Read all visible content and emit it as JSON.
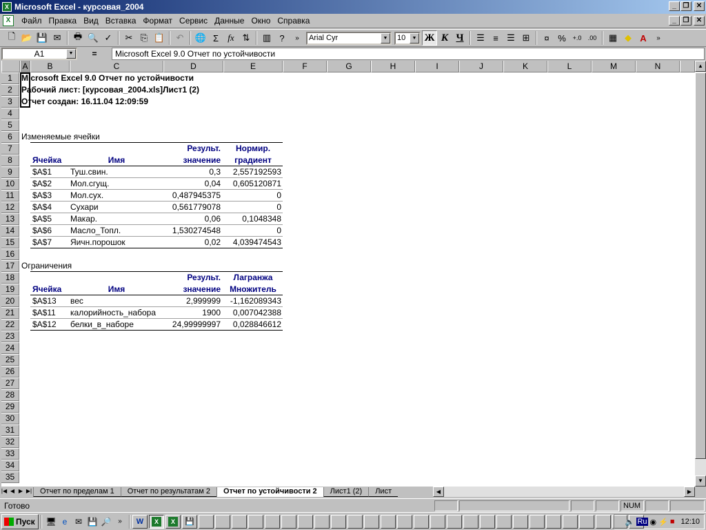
{
  "window": {
    "title": "Microsoft Excel - курсовая_2004"
  },
  "menu": [
    "Файл",
    "Правка",
    "Вид",
    "Вставка",
    "Формат",
    "Сервис",
    "Данные",
    "Окно",
    "Справка"
  ],
  "toolbar": {
    "font_name": "Arial Cyr",
    "font_size": "10",
    "bold": "Ж",
    "italic": "К",
    "underline": "Ч",
    "percent": "%",
    "sigma": "Σ",
    "fx": "fx"
  },
  "formula_bar": {
    "name_box": "A1",
    "equals": "=",
    "content": "Microsoft Excel 9.0 Отчет по устойчивости"
  },
  "columns": [
    "A",
    "B",
    "C",
    "D",
    "E",
    "F",
    "G",
    "H",
    "I",
    "J",
    "K",
    "L",
    "M",
    "N"
  ],
  "rows": [
    "1",
    "2",
    "3",
    "4",
    "5",
    "6",
    "7",
    "8",
    "9",
    "10",
    "11",
    "12",
    "13",
    "14",
    "15",
    "16",
    "17",
    "18",
    "19",
    "20",
    "21",
    "22",
    "23",
    "24",
    "25",
    "26",
    "27",
    "28",
    "29",
    "30",
    "31",
    "32",
    "33",
    "34",
    "35"
  ],
  "report": {
    "line1": "Microsoft Excel 9.0 Отчет по устойчивости",
    "line2": "Рабочий лист: [курсовая_2004.xls]Лист1 (2)",
    "line3": "Отчет создан: 16.11.04 12:09:59"
  },
  "changing_cells": {
    "section_title": "Изменяемые ячейки",
    "headers": {
      "cell": "Ячейка",
      "name": "Имя",
      "value_1": "Результ.",
      "value_2": "значение",
      "gradient_1": "Нормир.",
      "gradient_2": "градиент"
    },
    "rows": [
      {
        "cell": "$A$1",
        "name": "Туш.свин.",
        "value": "0,3",
        "gradient": "2,557192593"
      },
      {
        "cell": "$A$2",
        "name": "Мол.сгущ.",
        "value": "0,04",
        "gradient": "0,605120871"
      },
      {
        "cell": "$A$3",
        "name": "Мол.сух.",
        "value": "0,487945375",
        "gradient": "0"
      },
      {
        "cell": "$A$4",
        "name": "Сухари",
        "value": "0,561779078",
        "gradient": "0"
      },
      {
        "cell": "$A$5",
        "name": "Макар.",
        "value": "0,06",
        "gradient": "0,1048348"
      },
      {
        "cell": "$A$6",
        "name": "Масло_Топл.",
        "value": "1,530274548",
        "gradient": "0"
      },
      {
        "cell": "$A$7",
        "name": "Яичн.порошок",
        "value": "0,02",
        "gradient": "4,039474543"
      }
    ]
  },
  "constraints": {
    "section_title": "Ограничения",
    "headers": {
      "cell": "Ячейка",
      "name": "Имя",
      "value_1": "Результ.",
      "value_2": "значение",
      "lagrange_1": "Лагранжа",
      "lagrange_2": "Множитель"
    },
    "rows": [
      {
        "cell": "$A$13",
        "name": "вес",
        "value": "2,999999",
        "lagrange": "-1,162089343"
      },
      {
        "cell": "$A$11",
        "name": "калорийность_набора",
        "value": "1900",
        "lagrange": "0,007042388"
      },
      {
        "cell": "$A$12",
        "name": "белки_в_наборе",
        "value": "24,99999997",
        "lagrange": "0,028846612"
      }
    ]
  },
  "sheet_tabs": [
    {
      "label": "Отчет по пределам 1",
      "active": false
    },
    {
      "label": "Отчет по результатам 2",
      "active": false
    },
    {
      "label": "Отчет по устойчивости 2",
      "active": true
    },
    {
      "label": "Лист1 (2)",
      "active": false
    },
    {
      "label": "Лист",
      "active": false
    }
  ],
  "status": {
    "text": "Готово",
    "num": "NUM"
  },
  "taskbar": {
    "start": "Пуск",
    "lang": "Ru",
    "clock": "12:10"
  }
}
